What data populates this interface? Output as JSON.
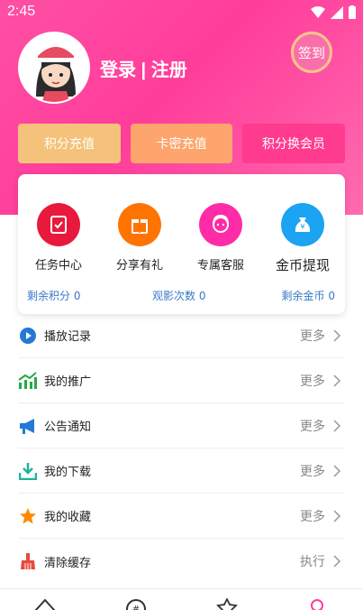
{
  "status": {
    "time": "2:45"
  },
  "header": {
    "login_text": "登录 | 注册",
    "signin": "签到"
  },
  "recharge": [
    "积分充值",
    "卡密充值",
    "积分换会员"
  ],
  "features": [
    {
      "label": "任务中心",
      "icon": "task-icon",
      "color": "#e8193c"
    },
    {
      "label": "分享有礼",
      "icon": "gift-icon",
      "color": "#ff7300"
    },
    {
      "label": "专属客服",
      "icon": "service-icon",
      "color": "#ff2ba7"
    },
    {
      "label": "金币提现",
      "icon": "money-bag-icon",
      "color": "#1ca3f2"
    }
  ],
  "stats": {
    "points": "剩余积分 0",
    "views": "观影次数 0",
    "coins": "剩余金币 0"
  },
  "menu": [
    {
      "label": "播放记录",
      "action": "更多",
      "icon": "play-icon"
    },
    {
      "label": "我的推广",
      "action": "更多",
      "icon": "chart-icon"
    },
    {
      "label": "公告通知",
      "action": "更多",
      "icon": "megaphone-icon"
    },
    {
      "label": "我的下载",
      "action": "更多",
      "icon": "download-icon"
    },
    {
      "label": "我的收藏",
      "action": "更多",
      "icon": "star-icon"
    },
    {
      "label": "清除缓存",
      "action": "执行",
      "icon": "broom-icon"
    }
  ]
}
